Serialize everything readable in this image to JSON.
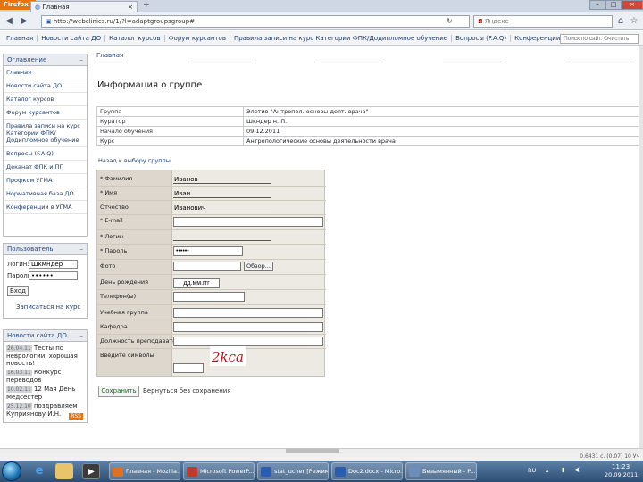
{
  "browser": {
    "app_button": "Firefox",
    "tab_title": "Главная",
    "tab_new": "+",
    "url": "http://webclinics.ru/1/?l=adaptgroupsgroup#",
    "search_placeholder": "Яндекс",
    "status_text": "0.6431 с. (0.07) 10 Уч"
  },
  "site_menu": {
    "items": [
      "Главная",
      "Новости сайта ДО",
      "Каталог курсов",
      "Форум курсантов",
      "Правила записи на курс Категории ФПК/Додипломное обучение",
      "Вопросы (F.A.Q)",
      "Конференции в УГМА"
    ],
    "search_placeholder": "Поиск по сайт. Очистить"
  },
  "sidebar": {
    "nav_title": "Оглавление",
    "nav_toggle": "–",
    "nav_items": [
      "Главная",
      "Новости сайта ДО",
      "Каталог курсов",
      "Форум курсантов",
      "Правила записи на курс Категории ФПК/Додипломное обучение",
      "Вопросы (F.A.Q)",
      "Деканат ФПК и ПП",
      "Профком УГМА",
      "Нормативная база ДО",
      "Конференции в УГМА"
    ],
    "user_title": "Пользователь",
    "user_toggle": "–",
    "login_label": "Логин:",
    "login_value": "Шкмндер",
    "password_label": "Пароль:",
    "password_value": "••••••",
    "login_button": "Вход",
    "register_link": "Записаться на курс",
    "news_title": "Новости сайта ДО",
    "news_toggle": "–",
    "news": [
      {
        "date": "26.04.11",
        "text": "Тесты по неврологии, хорошая новость!"
      },
      {
        "date": "16.03.11",
        "text": "Конкурс переводов"
      },
      {
        "date": "10.02.11",
        "text": "12 Мая День Медсестер"
      },
      {
        "date": "25.12.10",
        "text": "поздравляем Куприянову И.Н."
      }
    ],
    "rss": "RSS"
  },
  "main": {
    "breadcrumb": "Главная",
    "title": "Информация о группе",
    "info_rows": [
      {
        "key": "Группа",
        "value": "Элетив \"Антропол. основы деят. врача\""
      },
      {
        "key": "Куратор",
        "value": "Шкндер н. П."
      },
      {
        "key": "Начало обучения",
        "value": "09.12.2011"
      },
      {
        "key": "Курс",
        "value": "Антропологические основы деятельности врача"
      }
    ],
    "back_link": "Назад к выбору группы",
    "form": {
      "surname_label": "* Фамилия",
      "surname_value": "Иванов",
      "name_label": "* Имя",
      "name_value": "Иван",
      "patronymic_label": "Отчество",
      "patronymic_value": "Иванович",
      "email_label": "* E-mail",
      "email_value": "",
      "login_label": "* Логин",
      "login_value": "",
      "password_label": "* Пароль",
      "password_value": "••••••",
      "photo_label": "Фото",
      "browse_button": "Обзор...",
      "birthday_label": "День рождения",
      "birthday_value": "дд.мм.ггг",
      "phone_label": "Телефон(ы)",
      "phone_value": "",
      "study_group_label": "Учебная группа",
      "study_group_value": "",
      "department_label": "Кафедра",
      "department_value": "",
      "position_label": "Должность преподавателя",
      "position_value": "",
      "captcha_label": "Введите символы",
      "captcha_text": "2kca"
    },
    "save_button": "Сохранить",
    "return_link": "Вернуться без сохранения"
  },
  "taskbar": {
    "tasks": [
      {
        "label": "Главная - Mozilla...",
        "color": "#e07020"
      },
      {
        "label": "Microsoft PowerP...",
        "color": "#c0392b"
      },
      {
        "label": "stat_ucher [Режим...",
        "color": "#2a5db0"
      },
      {
        "label": "Doc2.docx - Micro...",
        "color": "#2a5db0"
      },
      {
        "label": "Безымянный - P...",
        "color": "#6b8fb8"
      }
    ],
    "lang": "RU",
    "time": "11:23",
    "date": "20.09.2011"
  },
  "colors": {
    "link": "#1d3b66",
    "accent": "#e8720c",
    "taskbar": "#2c4d73"
  }
}
